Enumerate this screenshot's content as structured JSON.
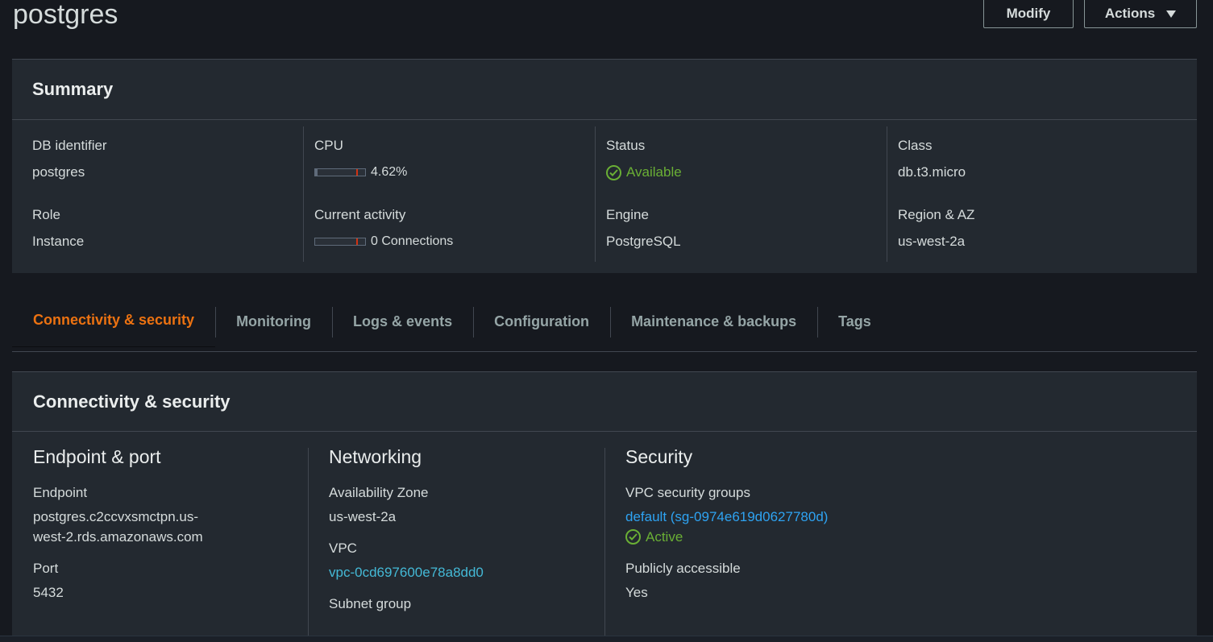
{
  "header": {
    "title": "postgres",
    "modify_label": "Modify",
    "actions_label": "Actions"
  },
  "summary": {
    "title": "Summary",
    "db_identifier": {
      "label": "DB identifier",
      "value": "postgres"
    },
    "role": {
      "label": "Role",
      "value": "Instance"
    },
    "cpu": {
      "label": "CPU",
      "value": "4.62%",
      "level": 0.0462
    },
    "current_activity": {
      "label": "Current activity",
      "value": "0 Connections",
      "level": 0
    },
    "status": {
      "label": "Status",
      "value": "Available",
      "color": "#6aaf35"
    },
    "engine": {
      "label": "Engine",
      "value": "PostgreSQL"
    },
    "class": {
      "label": "Class",
      "value": "db.t3.micro"
    },
    "region_az": {
      "label": "Region & AZ",
      "value": "us-west-2a"
    }
  },
  "tabs": [
    {
      "label": "Connectivity & security",
      "active": true
    },
    {
      "label": "Monitoring"
    },
    {
      "label": "Logs & events"
    },
    {
      "label": "Configuration"
    },
    {
      "label": "Maintenance & backups"
    },
    {
      "label": "Tags"
    }
  ],
  "connectivity": {
    "title": "Connectivity & security",
    "endpoint_port": {
      "title": "Endpoint & port",
      "endpoint_label": "Endpoint",
      "endpoint_line1": "postgres.c2ccvxsmctpn.us-",
      "endpoint_line2": "west-2.rds.amazonaws.com",
      "port_label": "Port",
      "port_value": "5432"
    },
    "networking": {
      "title": "Networking",
      "az_label": "Availability Zone",
      "az_value": "us-west-2a",
      "vpc_label": "VPC",
      "vpc_value": "vpc-0cd697600e78a8dd0",
      "subnet_label": "Subnet group"
    },
    "security": {
      "title": "Security",
      "sg_label": "VPC security groups",
      "sg_value": "default (sg-0974e619d0627780d)",
      "sg_status": "Active",
      "public_label": "Publicly accessible",
      "public_value": "Yes"
    }
  },
  "colors": {
    "accent": "#ec7211",
    "link": "#44b9d6",
    "success": "#6aaf35",
    "background": "#16191f",
    "panel": "#232930"
  },
  "icons": {
    "actions_caret": "caret-down-icon",
    "status_check": "check-circle-icon"
  }
}
